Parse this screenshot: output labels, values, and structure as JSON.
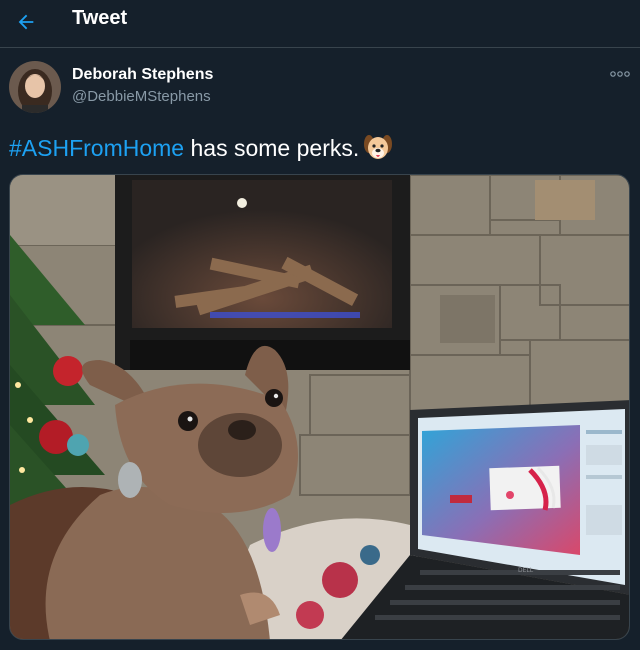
{
  "header": {
    "title": "Tweet",
    "back_icon": "arrow-left-icon"
  },
  "author": {
    "name": "Deborah Stephens",
    "handle": "@DebbieMStephens",
    "avatar_icon": "avatar"
  },
  "tweet": {
    "hashtag": "#ASHFromHome",
    "text": " has some perks.",
    "emoji": "dog-face-emoji"
  },
  "more_icon": "more-icon",
  "colors": {
    "background": "#15202b",
    "accent": "#1da1f2",
    "secondary_text": "#8899a6",
    "border": "#38444d"
  }
}
